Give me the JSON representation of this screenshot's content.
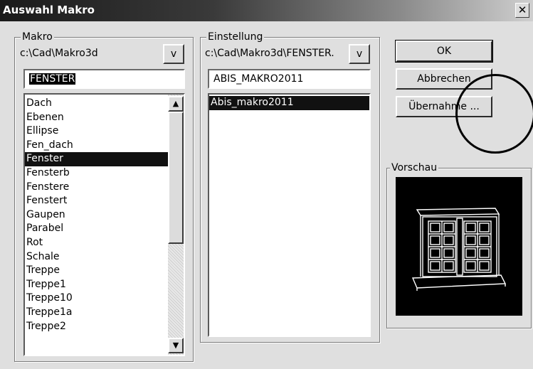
{
  "window": {
    "title": "Auswahl Makro",
    "close_glyph": "✕"
  },
  "makro": {
    "legend": "Makro",
    "path": "c:\\Cad\\Makro3d",
    "dropdown_label": "v",
    "input_value": "FENSTER",
    "items": [
      "Dach",
      "Ebenen",
      "Ellipse",
      "Fen_dach",
      "Fenster",
      "Fensterb",
      "Fenstere",
      "Fenstert",
      "Gaupen",
      "Parabel",
      "Rot",
      "Schale",
      "Treppe",
      "Treppe1",
      "Treppe10",
      "Treppe1a",
      "Treppe2"
    ],
    "selected_index": 4
  },
  "einstellung": {
    "legend": "Einstellung",
    "path": "c:\\Cad\\Makro3d\\FENSTER.",
    "dropdown_label": "v",
    "input_value": "ABIS_MAKRO2011",
    "items": [
      "Abis_makro2011"
    ],
    "selected_index": 0
  },
  "buttons": {
    "ok": "OK",
    "cancel": "Abbrechen",
    "apply": "Übernahme ..."
  },
  "preview": {
    "legend": "Vorschau",
    "icon": "window-3d-wireframe-icon"
  },
  "scroll": {
    "up_glyph": "▲",
    "down_glyph": "▼"
  },
  "colors": {
    "selection": "#111111",
    "preview_bg": "#000000",
    "annotation_ring": "#000000"
  }
}
